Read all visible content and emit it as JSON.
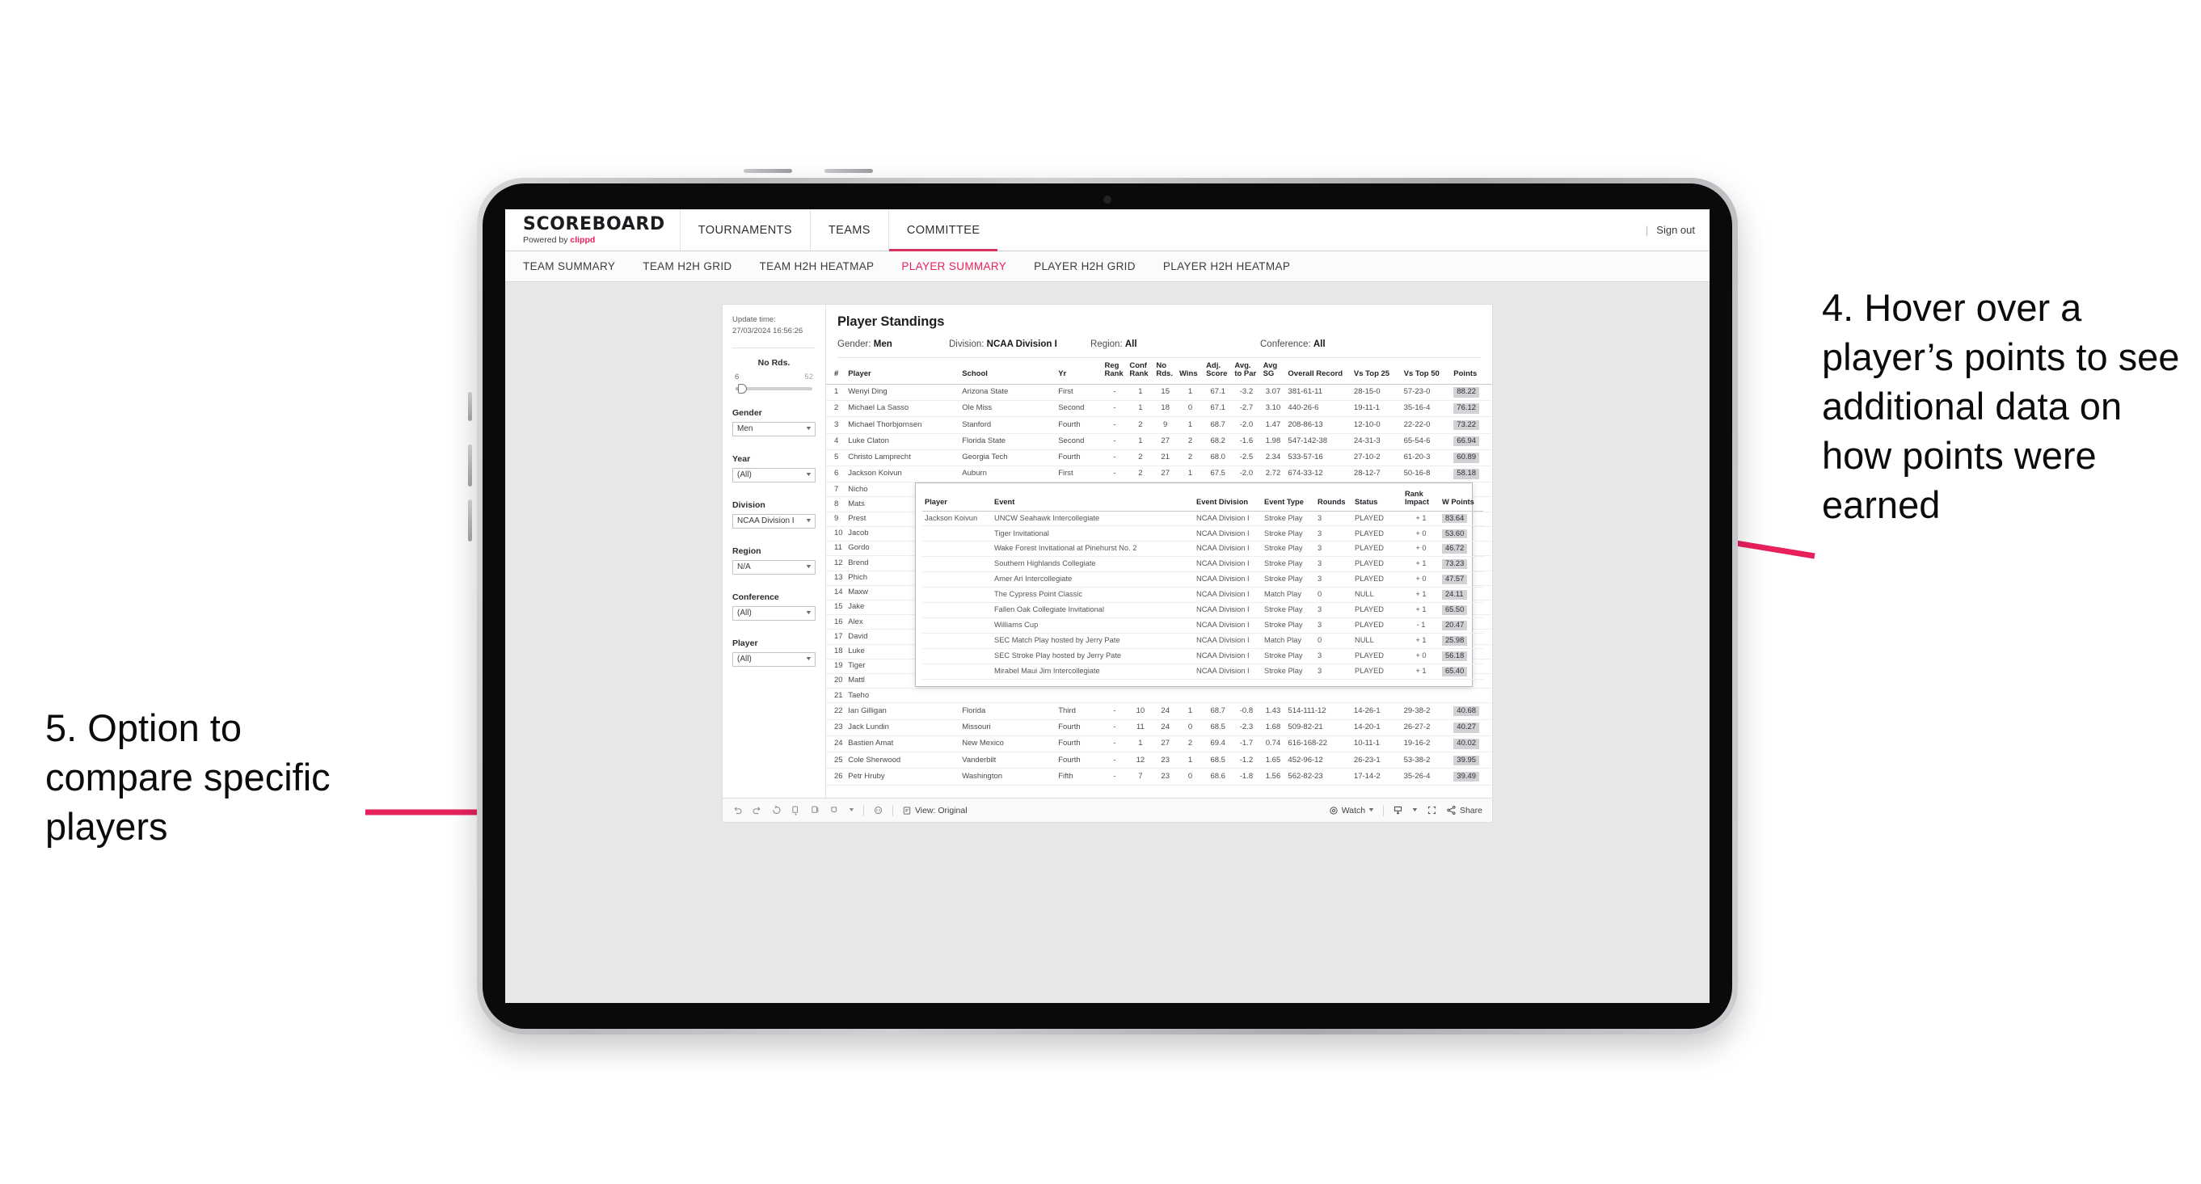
{
  "annotations": {
    "right": "4. Hover over a player’s points to see additional data on how points were earned",
    "left": "5. Option to compare specific players",
    "accent": "#e8215b"
  },
  "app": {
    "brand": {
      "title": "SCOREBOARD",
      "powered_prefix": "Powered by",
      "powered_brand": "clippd"
    },
    "topnav": [
      {
        "label": "TOURNAMENTS",
        "active": false
      },
      {
        "label": "TEAMS",
        "active": false
      },
      {
        "label": "COMMITTEE",
        "active": true
      }
    ],
    "account": {
      "divider": "|",
      "sign_out": "Sign out"
    },
    "subnav": [
      {
        "label": "TEAM SUMMARY",
        "active": false
      },
      {
        "label": "TEAM H2H GRID",
        "active": false
      },
      {
        "label": "TEAM H2H HEATMAP",
        "active": false
      },
      {
        "label": "PLAYER SUMMARY",
        "active": true
      },
      {
        "label": "PLAYER H2H GRID",
        "active": false
      },
      {
        "label": "PLAYER H2H HEATMAP",
        "active": false
      }
    ]
  },
  "filters": {
    "update_label": "Update time:",
    "update_value": "27/03/2024 16:56:26",
    "slider": {
      "title": "No Rds.",
      "min": "6",
      "max": "52"
    },
    "groups": [
      {
        "label": "Gender",
        "value": "Men"
      },
      {
        "label": "Year",
        "value": "(All)"
      },
      {
        "label": "Division",
        "value": "NCAA Division I"
      },
      {
        "label": "Region",
        "value": "N/A"
      },
      {
        "label": "Conference",
        "value": "(All)"
      },
      {
        "label": "Player",
        "value": "(All)"
      }
    ]
  },
  "viz": {
    "title": "Player Standings",
    "meta": [
      {
        "label": "Gender:",
        "value": "Men"
      },
      {
        "label": "Division:",
        "value": "NCAA Division I"
      },
      {
        "label": "Region:",
        "value": "All"
      },
      {
        "label": "Conference:",
        "value": "All"
      }
    ],
    "columns": [
      "#",
      "Player",
      "School",
      "Yr",
      "Reg Rank",
      "Conf Rank",
      "No Rds.",
      "Wins",
      "Adj. Score",
      "Avg. to Par",
      "Avg SG",
      "Overall Record",
      "Vs Top 25",
      "Vs Top 50",
      "Points"
    ],
    "rows": [
      {
        "n": "1",
        "player": "Wenyi Ding",
        "school": "Arizona State",
        "yr": "First",
        "reg": "-",
        "conf": "1",
        "rds": "15",
        "wins": "1",
        "adj": "67.1",
        "par": "-3.2",
        "sg": "3.07",
        "rec": "381-61-11",
        "t25": "28-15-0",
        "t50": "57-23-0",
        "pts": "88.22"
      },
      {
        "n": "2",
        "player": "Michael La Sasso",
        "school": "Ole Miss",
        "yr": "Second",
        "reg": "-",
        "conf": "1",
        "rds": "18",
        "wins": "0",
        "adj": "67.1",
        "par": "-2.7",
        "sg": "3.10",
        "rec": "440-26-6",
        "t25": "19-11-1",
        "t50": "35-16-4",
        "pts": "76.12"
      },
      {
        "n": "3",
        "player": "Michael Thorbjornsen",
        "school": "Stanford",
        "yr": "Fourth",
        "reg": "-",
        "conf": "2",
        "rds": "9",
        "wins": "1",
        "adj": "68.7",
        "par": "-2.0",
        "sg": "1.47",
        "rec": "208-86-13",
        "t25": "12-10-0",
        "t50": "22-22-0",
        "pts": "73.22"
      },
      {
        "n": "4",
        "player": "Luke Claton",
        "school": "Florida State",
        "yr": "Second",
        "reg": "-",
        "conf": "1",
        "rds": "27",
        "wins": "2",
        "adj": "68.2",
        "par": "-1.6",
        "sg": "1.98",
        "rec": "547-142-38",
        "t25": "24-31-3",
        "t50": "65-54-6",
        "pts": "66.94"
      },
      {
        "n": "5",
        "player": "Christo Lamprecht",
        "school": "Georgia Tech",
        "yr": "Fourth",
        "reg": "-",
        "conf": "2",
        "rds": "21",
        "wins": "2",
        "adj": "68.0",
        "par": "-2.5",
        "sg": "2.34",
        "rec": "533-57-16",
        "t25": "27-10-2",
        "t50": "61-20-3",
        "pts": "60.89"
      },
      {
        "n": "6",
        "player": "Jackson Koivun",
        "school": "Auburn",
        "yr": "First",
        "reg": "-",
        "conf": "2",
        "rds": "27",
        "wins": "1",
        "adj": "67.5",
        "par": "-2.0",
        "sg": "2.72",
        "rec": "674-33-12",
        "t25": "28-12-7",
        "t50": "50-16-8",
        "pts": "58.18"
      },
      {
        "n": "7",
        "player": "Nicho",
        "school": "",
        "yr": "",
        "reg": "",
        "conf": "",
        "rds": "",
        "wins": "",
        "adj": "",
        "par": "",
        "sg": "",
        "rec": "",
        "t25": "",
        "t50": "",
        "pts": ""
      },
      {
        "n": "8",
        "player": "Mats",
        "school": "",
        "yr": "",
        "reg": "",
        "conf": "",
        "rds": "",
        "wins": "",
        "adj": "",
        "par": "",
        "sg": "",
        "rec": "",
        "t25": "",
        "t50": "",
        "pts": ""
      },
      {
        "n": "9",
        "player": "Prest",
        "school": "",
        "yr": "",
        "reg": "",
        "conf": "",
        "rds": "",
        "wins": "",
        "adj": "",
        "par": "",
        "sg": "",
        "rec": "",
        "t25": "",
        "t50": "",
        "pts": ""
      },
      {
        "n": "10",
        "player": "Jacob",
        "school": "",
        "yr": "",
        "reg": "",
        "conf": "",
        "rds": "",
        "wins": "",
        "adj": "",
        "par": "",
        "sg": "",
        "rec": "",
        "t25": "",
        "t50": "",
        "pts": ""
      },
      {
        "n": "11",
        "player": "Gordo",
        "school": "",
        "yr": "",
        "reg": "",
        "conf": "",
        "rds": "",
        "wins": "",
        "adj": "",
        "par": "",
        "sg": "",
        "rec": "",
        "t25": "",
        "t50": "",
        "pts": ""
      },
      {
        "n": "12",
        "player": "Brend",
        "school": "",
        "yr": "",
        "reg": "",
        "conf": "",
        "rds": "",
        "wins": "",
        "adj": "",
        "par": "",
        "sg": "",
        "rec": "",
        "t25": "",
        "t50": "",
        "pts": ""
      },
      {
        "n": "13",
        "player": "Phich",
        "school": "",
        "yr": "",
        "reg": "",
        "conf": "",
        "rds": "",
        "wins": "",
        "adj": "",
        "par": "",
        "sg": "",
        "rec": "",
        "t25": "",
        "t50": "",
        "pts": ""
      },
      {
        "n": "14",
        "player": "Maxw",
        "school": "",
        "yr": "",
        "reg": "",
        "conf": "",
        "rds": "",
        "wins": "",
        "adj": "",
        "par": "",
        "sg": "",
        "rec": "",
        "t25": "",
        "t50": "",
        "pts": ""
      },
      {
        "n": "15",
        "player": "Jake",
        "school": "",
        "yr": "",
        "reg": "",
        "conf": "",
        "rds": "",
        "wins": "",
        "adj": "",
        "par": "",
        "sg": "",
        "rec": "",
        "t25": "",
        "t50": "",
        "pts": ""
      },
      {
        "n": "16",
        "player": "Alex",
        "school": "",
        "yr": "",
        "reg": "",
        "conf": "",
        "rds": "",
        "wins": "",
        "adj": "",
        "par": "",
        "sg": "",
        "rec": "",
        "t25": "",
        "t50": "",
        "pts": ""
      },
      {
        "n": "17",
        "player": "David",
        "school": "",
        "yr": "",
        "reg": "",
        "conf": "",
        "rds": "",
        "wins": "",
        "adj": "",
        "par": "",
        "sg": "",
        "rec": "",
        "t25": "",
        "t50": "",
        "pts": ""
      },
      {
        "n": "18",
        "player": "Luke",
        "school": "",
        "yr": "",
        "reg": "",
        "conf": "",
        "rds": "",
        "wins": "",
        "adj": "",
        "par": "",
        "sg": "",
        "rec": "",
        "t25": "",
        "t50": "",
        "pts": ""
      },
      {
        "n": "19",
        "player": "Tiger",
        "school": "",
        "yr": "",
        "reg": "",
        "conf": "",
        "rds": "",
        "wins": "",
        "adj": "",
        "par": "",
        "sg": "",
        "rec": "",
        "t25": "",
        "t50": "",
        "pts": ""
      },
      {
        "n": "20",
        "player": "Mattl",
        "school": "",
        "yr": "",
        "reg": "",
        "conf": "",
        "rds": "",
        "wins": "",
        "adj": "",
        "par": "",
        "sg": "",
        "rec": "",
        "t25": "",
        "t50": "",
        "pts": ""
      },
      {
        "n": "21",
        "player": "Taeho",
        "school": "",
        "yr": "",
        "reg": "",
        "conf": "",
        "rds": "",
        "wins": "",
        "adj": "",
        "par": "",
        "sg": "",
        "rec": "",
        "t25": "",
        "t50": "",
        "pts": ""
      },
      {
        "n": "22",
        "player": "Ian Gilligan",
        "school": "Florida",
        "yr": "Third",
        "reg": "-",
        "conf": "10",
        "rds": "24",
        "wins": "1",
        "adj": "68.7",
        "par": "-0.8",
        "sg": "1.43",
        "rec": "514-111-12",
        "t25": "14-26-1",
        "t50": "29-38-2",
        "pts": "40.68"
      },
      {
        "n": "23",
        "player": "Jack Lundin",
        "school": "Missouri",
        "yr": "Fourth",
        "reg": "-",
        "conf": "11",
        "rds": "24",
        "wins": "0",
        "adj": "68.5",
        "par": "-2.3",
        "sg": "1.68",
        "rec": "509-82-21",
        "t25": "14-20-1",
        "t50": "26-27-2",
        "pts": "40.27"
      },
      {
        "n": "24",
        "player": "Bastien Amat",
        "school": "New Mexico",
        "yr": "Fourth",
        "reg": "-",
        "conf": "1",
        "rds": "27",
        "wins": "2",
        "adj": "69.4",
        "par": "-1.7",
        "sg": "0.74",
        "rec": "616-168-22",
        "t25": "10-11-1",
        "t50": "19-16-2",
        "pts": "40.02"
      },
      {
        "n": "25",
        "player": "Cole Sherwood",
        "school": "Vanderbilt",
        "yr": "Fourth",
        "reg": "-",
        "conf": "12",
        "rds": "23",
        "wins": "1",
        "adj": "68.5",
        "par": "-1.2",
        "sg": "1.65",
        "rec": "452-96-12",
        "t25": "26-23-1",
        "t50": "53-38-2",
        "pts": "39.95"
      },
      {
        "n": "26",
        "player": "Petr Hruby",
        "school": "Washington",
        "yr": "Fifth",
        "reg": "-",
        "conf": "7",
        "rds": "23",
        "wins": "0",
        "adj": "68.6",
        "par": "-1.8",
        "sg": "1.56",
        "rec": "562-82-23",
        "t25": "17-14-2",
        "t50": "35-26-4",
        "pts": "39.49"
      }
    ]
  },
  "tooltip": {
    "columns": [
      "Player",
      "Event",
      "Event Division",
      "Event Type",
      "Rounds",
      "Status",
      "Rank Impact",
      "W Points"
    ],
    "player": "Jackson Koivun",
    "rows": [
      {
        "event": "UNCW Seahawk Intercollegiate",
        "div": "NCAA Division I",
        "type": "Stroke Play",
        "rounds": "3",
        "status": "PLAYED",
        "rank": "+ 1",
        "pts": "83.64"
      },
      {
        "event": "Tiger Invitational",
        "div": "NCAA Division I",
        "type": "Stroke Play",
        "rounds": "3",
        "status": "PLAYED",
        "rank": "+ 0",
        "pts": "53.60"
      },
      {
        "event": "Wake Forest Invitational at Pinehurst No. 2",
        "div": "NCAA Division I",
        "type": "Stroke Play",
        "rounds": "3",
        "status": "PLAYED",
        "rank": "+ 0",
        "pts": "46.72"
      },
      {
        "event": "Southern Highlands Collegiate",
        "div": "NCAA Division I",
        "type": "Stroke Play",
        "rounds": "3",
        "status": "PLAYED",
        "rank": "+ 1",
        "pts": "73.23"
      },
      {
        "event": "Amer Ari Intercollegiate",
        "div": "NCAA Division I",
        "type": "Stroke Play",
        "rounds": "3",
        "status": "PLAYED",
        "rank": "+ 0",
        "pts": "47.57"
      },
      {
        "event": "The Cypress Point Classic",
        "div": "NCAA Division I",
        "type": "Match Play",
        "rounds": "0",
        "status": "NULL",
        "rank": "+ 1",
        "pts": "24.11"
      },
      {
        "event": "Fallen Oak Collegiate Invitational",
        "div": "NCAA Division I",
        "type": "Stroke Play",
        "rounds": "3",
        "status": "PLAYED",
        "rank": "+ 1",
        "pts": "65.50"
      },
      {
        "event": "Williams Cup",
        "div": "NCAA Division I",
        "type": "Stroke Play",
        "rounds": "3",
        "status": "PLAYED",
        "rank": "- 1",
        "pts": "20.47"
      },
      {
        "event": "SEC Match Play hosted by Jerry Pate",
        "div": "NCAA Division I",
        "type": "Match Play",
        "rounds": "0",
        "status": "NULL",
        "rank": "+ 1",
        "pts": "25.98"
      },
      {
        "event": "SEC Stroke Play hosted by Jerry Pate",
        "div": "NCAA Division I",
        "type": "Stroke Play",
        "rounds": "3",
        "status": "PLAYED",
        "rank": "+ 0",
        "pts": "56.18"
      },
      {
        "event": "Mirabel Maui Jim Intercollegiate",
        "div": "NCAA Division I",
        "type": "Stroke Play",
        "rounds": "3",
        "status": "PLAYED",
        "rank": "+ 1",
        "pts": "65.40"
      }
    ]
  },
  "toolbar": {
    "view_label": "View: Original",
    "watch_label": "Watch",
    "share_label": "Share"
  }
}
